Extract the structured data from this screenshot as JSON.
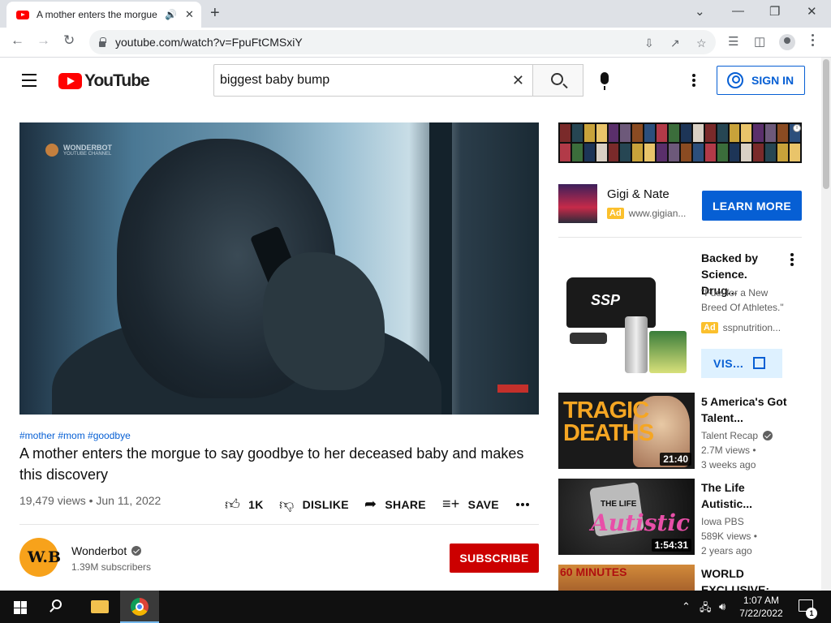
{
  "browser": {
    "tab_title": "A mother enters the morgue",
    "url": "youtube.com/watch?v=FpuFtCMSxiY"
  },
  "youtube": {
    "logo_text": "YouTube",
    "search_value": "biggest baby bump",
    "sign_in": "SIGN IN"
  },
  "video": {
    "watermark": "WONDERBOT",
    "watermark_sub": "YOUTUBE CHANNEL",
    "hashtags": "#mother #mom #goodbye",
    "title": "A mother enters the morgue to say goodbye to her deceased baby and makes this discovery",
    "meta": "19,479 views • Jun 11, 2022",
    "actions": {
      "like": "1K",
      "dislike": "DISLIKE",
      "share": "SHARE",
      "save": "SAVE"
    },
    "channel": {
      "avatar_text": "W.B",
      "name": "Wonderbot",
      "subscribers": "1.39M subscribers",
      "subscribe": "SUBSCRIBE"
    }
  },
  "sidebar": {
    "ad1": {
      "title": "Gigi & Nate",
      "badge": "Ad",
      "domain": "www.gigian...",
      "cta": "LEARN MORE"
    },
    "ad2": {
      "title": "Backed by Science. Drug...",
      "description": "\"Fuel for a New Breed Of Athletes.\"",
      "badge": "Ad",
      "domain": "sspnutrition...",
      "cta": "VIS..."
    },
    "recommendations": [
      {
        "title": "5 America's Got Talent...",
        "channel": "Talent Recap",
        "verified": true,
        "views": "2.7M views •",
        "age": "3 weeks ago",
        "duration": "21:40",
        "thumb_text": "TRAGIC DEATHS"
      },
      {
        "title": "The Life Autistic...",
        "channel": "Iowa PBS",
        "verified": false,
        "views": "589K views •",
        "age": "2 years ago",
        "duration": "1:54:31",
        "thumb_text": "Autistic",
        "thumb_sub": "THE LIFE"
      },
      {
        "title": "WORLD EXCLUSIVE:",
        "thumb_text": "60 MINUTES"
      }
    ]
  },
  "taskbar": {
    "time": "1:07 AM",
    "date": "7/22/2022",
    "notifications": "1"
  }
}
